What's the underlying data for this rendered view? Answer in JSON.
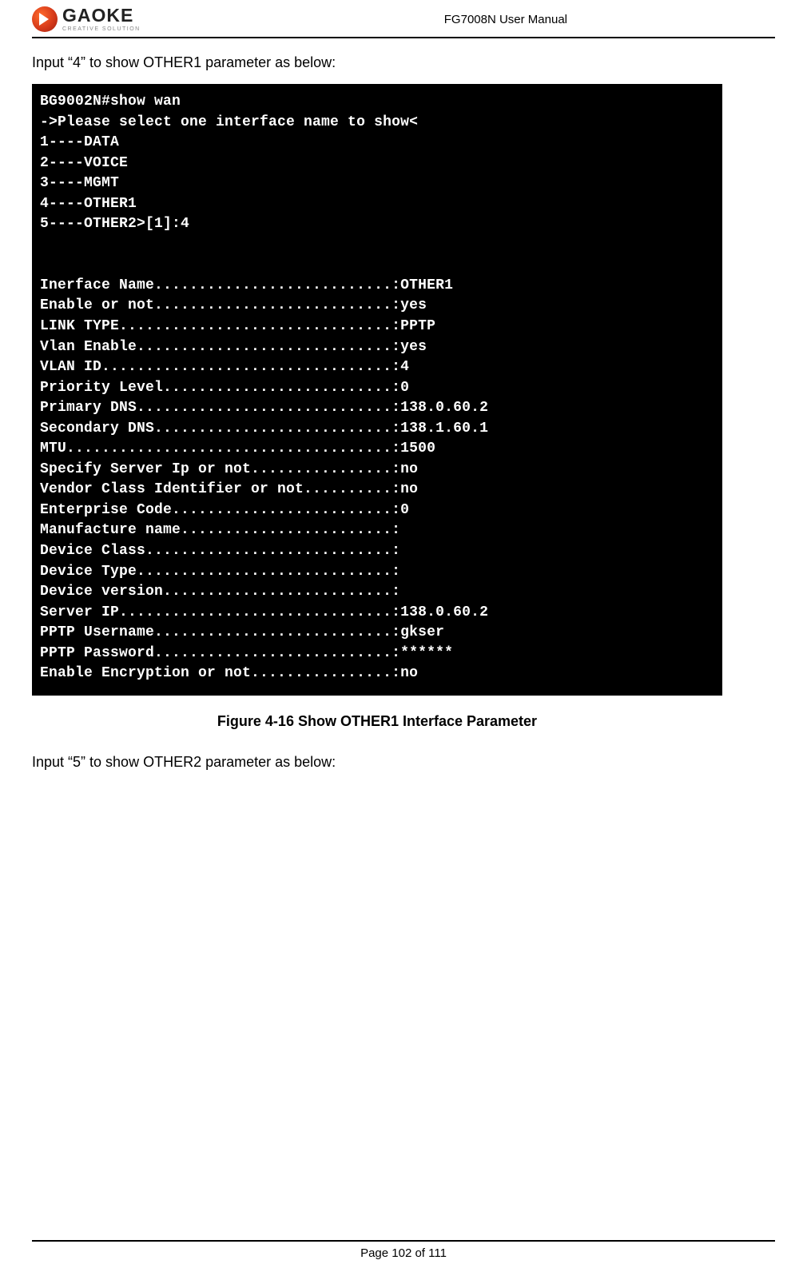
{
  "header": {
    "logo_word": "GAOKE",
    "logo_tag": "CREATIVE SOLUTION",
    "doc_title": "FG7008N User Manual"
  },
  "intro1": "Input “4” to show OTHER1 parameter as below:",
  "terminal": {
    "prompt": "BG9002N#show wan",
    "select_hint": "->Please select one interface name to show<",
    "options": [
      "1----DATA",
      "2----VOICE",
      "3----MGMT",
      "4----OTHER1",
      "5----OTHER2>[1]:4"
    ],
    "params": [
      {
        "label": "Inerface Name",
        "value": "OTHER1"
      },
      {
        "label": "Enable or not",
        "value": "yes"
      },
      {
        "label": "LINK TYPE",
        "value": "PPTP"
      },
      {
        "label": "Vlan Enable",
        "value": "yes"
      },
      {
        "label": "VLAN ID",
        "value": "4"
      },
      {
        "label": "Priority Level",
        "value": "0"
      },
      {
        "label": "Primary DNS",
        "value": "138.0.60.2"
      },
      {
        "label": "Secondary DNS",
        "value": "138.1.60.1"
      },
      {
        "label": "MTU",
        "value": "1500"
      },
      {
        "label": "Specify Server Ip or not",
        "value": "no"
      },
      {
        "label": "Vendor Class Identifier or not",
        "value": "no"
      },
      {
        "label": "Enterprise Code",
        "value": "0"
      },
      {
        "label": "Manufacture name",
        "value": ""
      },
      {
        "label": "Device Class",
        "value": ""
      },
      {
        "label": "Device Type",
        "value": ""
      },
      {
        "label": "Device version",
        "value": ""
      },
      {
        "label": "Server IP",
        "value": "138.0.60.2"
      },
      {
        "label": "PPTP Username",
        "value": "gkser"
      },
      {
        "label": "PPTP Password",
        "value": "******"
      },
      {
        "label": "Enable Encryption or not",
        "value": "no"
      }
    ],
    "dot_col": 40
  },
  "figure_caption": "Figure 4-16  Show OTHER1 Interface Parameter",
  "intro2": "Input “5” to show OTHER2 parameter as below:",
  "footer": "Page 102 of 111"
}
